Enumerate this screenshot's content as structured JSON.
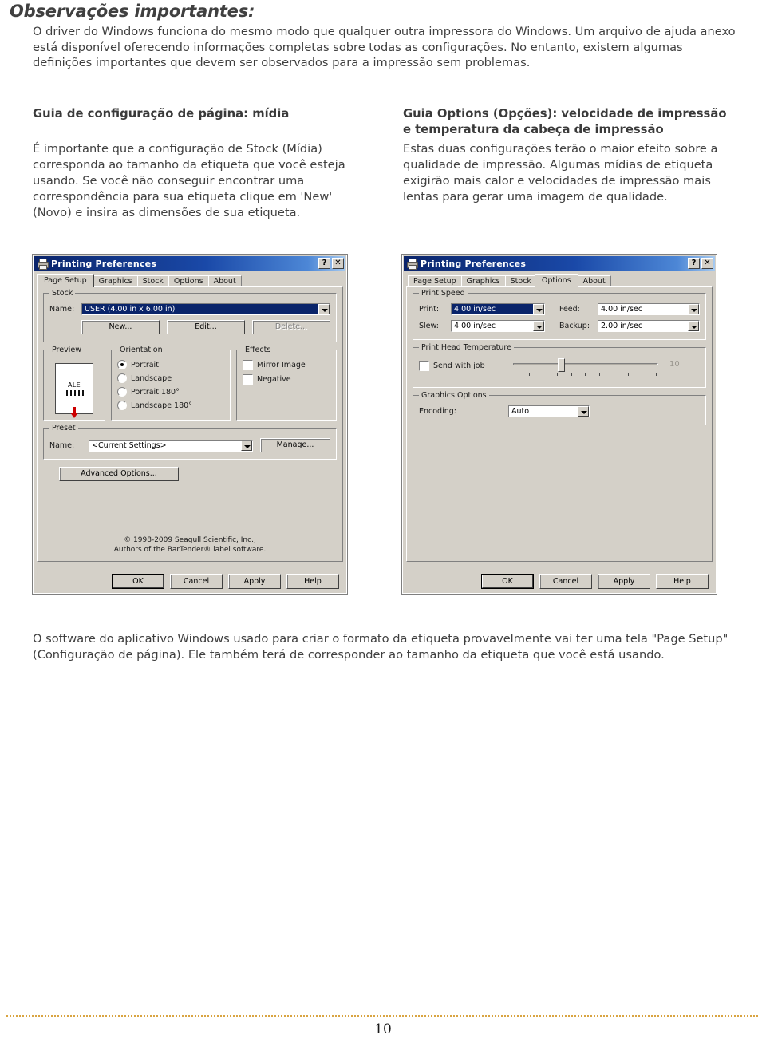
{
  "document": {
    "title": "Observações importantes:",
    "intro": "O driver do Windows funciona do mesmo modo que qualquer outra impressora do Windows. Um arquivo de ajuda anexo está disponível oferecendo informações completas sobre todas as configurações. No entanto, existem algumas definições importantes que devem ser observados para a impressão sem problemas.",
    "closing": "O software do aplicativo Windows usado para criar o formato da etiqueta provavelmente vai ter uma tela \"Page Setup\" (Configuração de página). Ele também terá de corresponder ao tamanho da etiqueta que você está usando.",
    "page_number": "10"
  },
  "columns": {
    "left": {
      "heading": "Guia de configuração de página: mídia",
      "body": "É importante que a configuração de Stock (Mídia) corresponda ao tamanho da etiqueta que você esteja usando. Se você não conseguir encontrar uma correspondência para sua etiqueta clique em 'New' (Novo) e insira as dimensões de sua etiqueta."
    },
    "right": {
      "heading": "Guia Options (Opções): velocidade de impressão e temperatura da cabeça de impressão",
      "body": "Estas duas configurações terão o maior efeito sobre a qualidade de impressão. Algumas mídias de etiqueta exigirão mais calor e velocidades de impressão mais lentas para gerar uma imagem de qualidade."
    }
  },
  "dialog_page_setup": {
    "title": "Printing Preferences",
    "help_button": "?",
    "close_button": "✕",
    "tabs": [
      {
        "label": "Page Setup",
        "active": true
      },
      {
        "label": "Graphics",
        "active": false
      },
      {
        "label": "Stock",
        "active": false
      },
      {
        "label": "Options",
        "active": false
      },
      {
        "label": "About",
        "active": false
      }
    ],
    "stock": {
      "group_title": "Stock",
      "name_label": "Name:",
      "name_value": "USER (4.00 in x 6.00 in)",
      "new_button": "New...",
      "edit_button": "Edit...",
      "delete_button": "Delete..."
    },
    "preview": {
      "group_title": "Preview",
      "label_text": "ALE"
    },
    "orientation": {
      "group_title": "Orientation",
      "options": [
        {
          "label": "Portrait",
          "selected": true
        },
        {
          "label": "Landscape",
          "selected": false
        },
        {
          "label": "Portrait 180°",
          "selected": false
        },
        {
          "label": "Landscape 180°",
          "selected": false
        }
      ]
    },
    "effects": {
      "group_title": "Effects",
      "options": [
        {
          "label": "Mirror Image",
          "checked": false
        },
        {
          "label": "Negative",
          "checked": false
        }
      ]
    },
    "preset": {
      "group_title": "Preset",
      "name_label": "Name:",
      "name_value": "<Current Settings>",
      "manage_button": "Manage..."
    },
    "advanced_button": "Advanced Options...",
    "copyright_line1": "© 1998-2009 Seagull Scientific, Inc.,",
    "copyright_line2": "Authors of the BarTender® label software.",
    "buttons": {
      "ok": "OK",
      "cancel": "Cancel",
      "apply": "Apply",
      "help": "Help"
    }
  },
  "dialog_options": {
    "title": "Printing Preferences",
    "help_button": "?",
    "close_button": "✕",
    "tabs": [
      {
        "label": "Page Setup",
        "active": false
      },
      {
        "label": "Graphics",
        "active": false
      },
      {
        "label": "Stock",
        "active": false
      },
      {
        "label": "Options",
        "active": true
      },
      {
        "label": "About",
        "active": false
      }
    ],
    "print_speed": {
      "group_title": "Print Speed",
      "print_label": "Print:",
      "print_value": "4.00 in/sec",
      "feed_label": "Feed:",
      "feed_value": "4.00 in/sec",
      "slew_label": "Slew:",
      "slew_value": "4.00 in/sec",
      "backup_label": "Backup:",
      "backup_value": "2.00 in/sec"
    },
    "print_head_temperature": {
      "group_title": "Print Head Temperature",
      "send_with_job_label": "Send with job",
      "send_with_job_checked": false,
      "slider_value": "10",
      "slider_tick_count": 11
    },
    "graphics_options": {
      "group_title": "Graphics Options",
      "encoding_label": "Encoding:",
      "encoding_value": "Auto"
    },
    "buttons": {
      "ok": "OK",
      "cancel": "Cancel",
      "apply": "Apply",
      "help": "Help"
    }
  },
  "colors": {
    "title_gray": "#404040",
    "body_gray": "#3f3f3f",
    "dialog_face": "#d4d0c8",
    "titlebar_blue": "#0a246a",
    "selection_blue": "#0a246a",
    "footer_rule": "#d9a441",
    "preview_arrow_red": "#cc0000"
  }
}
